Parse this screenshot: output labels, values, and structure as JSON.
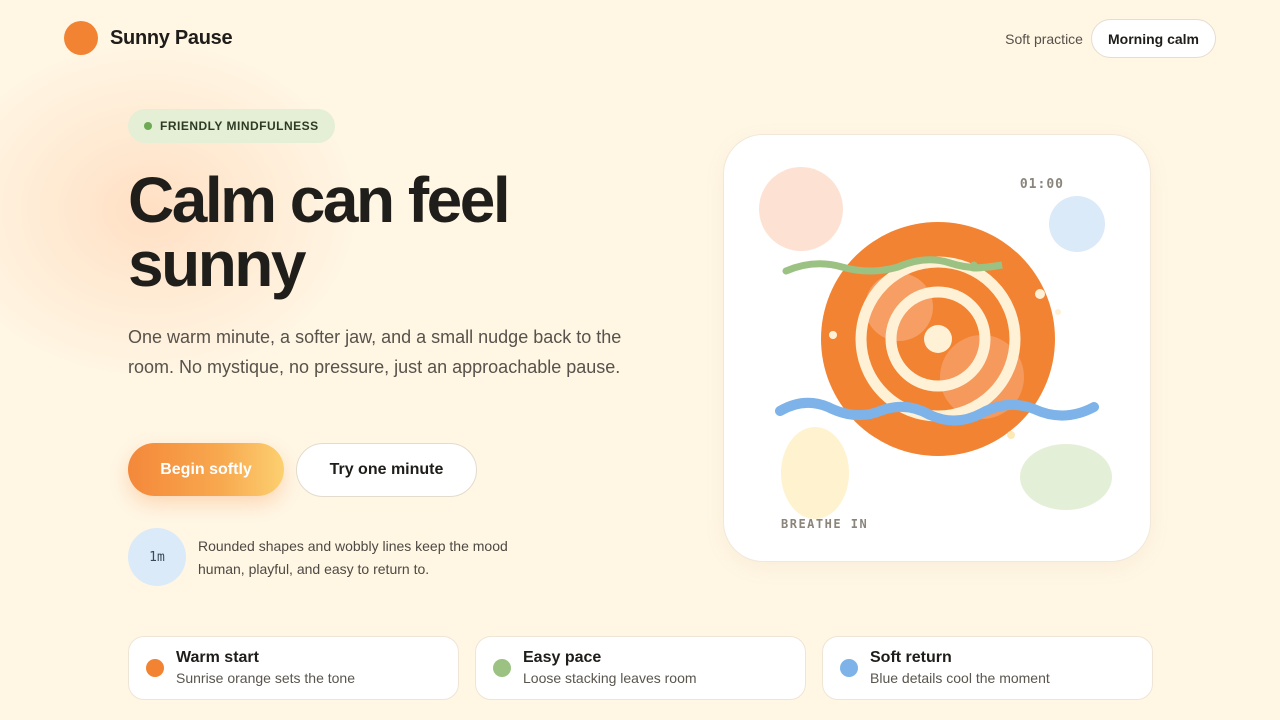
{
  "brand": {
    "name": "Sunny Pause"
  },
  "header": {
    "nav_link": "Soft practice",
    "pill_label": "Morning calm"
  },
  "hero": {
    "badge": "FRIENDLY MINDFULNESS",
    "headline": "Calm can feel sunny",
    "body": "One warm minute, a softer jaw, and a small nudge back to the room. No mystique, no pressure, just an approachable pause.",
    "primary_button": "Begin softly",
    "secondary_button": "Try one minute",
    "minute_chip": "1m",
    "note": "Rounded shapes and wobbly lines keep the mood human, playful, and easy to return to."
  },
  "card": {
    "timer": "01:00",
    "caption": "BREATHE IN"
  },
  "features": [
    {
      "title": "Warm start",
      "subtitle": "Sunrise orange sets the tone",
      "color": "#f28332"
    },
    {
      "title": "Easy pace",
      "subtitle": "Loose stacking leaves room",
      "color": "#9cc283"
    },
    {
      "title": "Soft return",
      "subtitle": "Blue details cool the moment",
      "color": "#7db3e8"
    }
  ],
  "colors": {
    "accent": "#f28332",
    "green": "#9cc283",
    "blue": "#7db3e8",
    "background": "#fff6e4"
  }
}
